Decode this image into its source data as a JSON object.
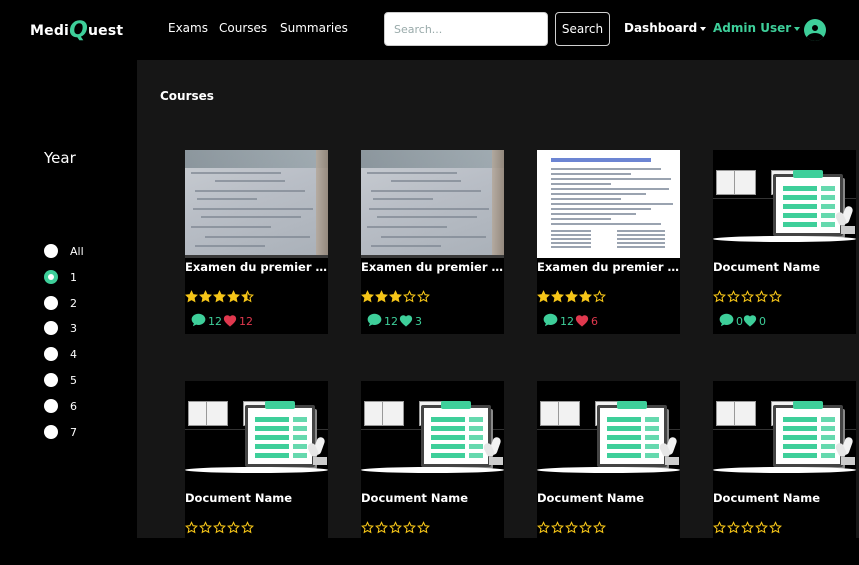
{
  "brand": {
    "part1": "Medi",
    "q": "Q",
    "part2": "uest"
  },
  "nav": {
    "exams": "Exams",
    "courses": "Courses",
    "summaries": "Summaries"
  },
  "search": {
    "placeholder": "Search...",
    "button": "Search"
  },
  "dashboard": "Dashboard",
  "user": "Admin User",
  "colors": {
    "accent": "#3ecf9a",
    "heart_red": "#e0384e",
    "star": "#f5c518",
    "comment_green": "#3ecf9a"
  },
  "sidebar": {
    "title": "Year",
    "options": [
      {
        "label": "All",
        "checked": false
      },
      {
        "label": "1",
        "checked": true
      },
      {
        "label": "2",
        "checked": false
      },
      {
        "label": "3",
        "checked": false
      },
      {
        "label": "4",
        "checked": false
      },
      {
        "label": "5",
        "checked": false
      },
      {
        "label": "6",
        "checked": false
      },
      {
        "label": "7",
        "checked": false
      }
    ]
  },
  "section_title": "Courses",
  "cards": [
    {
      "title": "Examen du premier tri...",
      "thumb": "photo",
      "rating": 4.5,
      "comments": "12",
      "likes": "12",
      "heart": "red"
    },
    {
      "title": "Examen du premier tri...",
      "thumb": "photo",
      "rating": 3,
      "comments": "12",
      "likes": "3",
      "heart": "green"
    },
    {
      "title": "Examen du premier tri...",
      "thumb": "doc",
      "rating": 4,
      "comments": "12",
      "likes": "6",
      "heart": "red"
    },
    {
      "title": "Document Name",
      "thumb": "illustration",
      "rating": 0,
      "comments": "0",
      "likes": "0",
      "heart": "green"
    },
    {
      "title": "Document Name",
      "thumb": "illustration",
      "rating": 0
    },
    {
      "title": "Document Name",
      "thumb": "illustration",
      "rating": 0
    },
    {
      "title": "Document Name",
      "thumb": "illustration",
      "rating": 0
    },
    {
      "title": "Document Name",
      "thumb": "illustration",
      "rating": 0
    }
  ]
}
